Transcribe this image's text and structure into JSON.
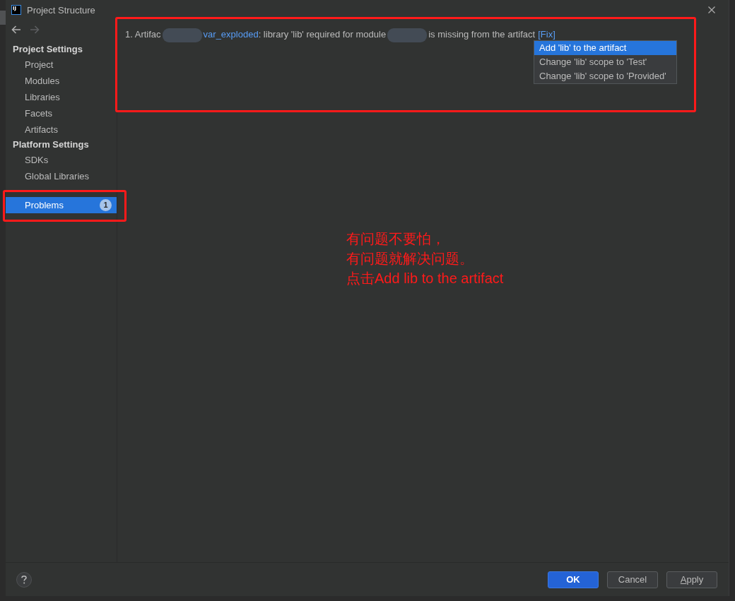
{
  "window": {
    "title": "Project Structure",
    "logo_text": "IJ"
  },
  "navigation": {
    "back_enabled": true,
    "forward_enabled": false
  },
  "sidebar": {
    "groups": [
      {
        "heading": "Project Settings",
        "items": [
          {
            "label": "Project",
            "selected": false
          },
          {
            "label": "Modules",
            "selected": false
          },
          {
            "label": "Libraries",
            "selected": false
          },
          {
            "label": "Facets",
            "selected": false
          },
          {
            "label": "Artifacts",
            "selected": false
          }
        ]
      },
      {
        "heading": "Platform Settings",
        "items": [
          {
            "label": "SDKs",
            "selected": false
          },
          {
            "label": "Global Libraries",
            "selected": false
          }
        ]
      }
    ],
    "bottom_items": [
      {
        "label": "Problems",
        "selected": true,
        "badge": "1",
        "highlighted": true
      }
    ]
  },
  "problems_panel": {
    "highlighted": true,
    "problems": [
      {
        "segments": [
          {
            "kind": "text",
            "text": "1. Artifac"
          },
          {
            "kind": "redacted"
          },
          {
            "kind": "link",
            "text": "var_exploded"
          },
          {
            "kind": "text",
            "text": ": library 'lib' required for module"
          },
          {
            "kind": "redacted"
          },
          {
            "kind": "text",
            "text": "is missing from the artifact"
          },
          {
            "kind": "fix_link",
            "text": "[Fix]"
          }
        ],
        "fix_menu": {
          "open": true,
          "items": [
            {
              "label": "Add 'lib' to the artifact",
              "selected": true
            },
            {
              "label": "Change 'lib' scope to 'Test'",
              "selected": false
            },
            {
              "label": "Change 'lib' scope to 'Provided'",
              "selected": false
            }
          ]
        }
      }
    ]
  },
  "annotation": {
    "lines": [
      "有问题不要怕，",
      "有问题就解决问题。",
      "点击Add lib to the artifact"
    ]
  },
  "footer": {
    "buttons": [
      {
        "label": "OK",
        "kind": "primary",
        "mnemonic_underlined": false
      },
      {
        "label": "Cancel",
        "kind": "secondary",
        "mnemonic_underlined": false
      },
      {
        "label": "Apply",
        "kind": "secondary",
        "mnemonic_underlined": true
      }
    ]
  }
}
